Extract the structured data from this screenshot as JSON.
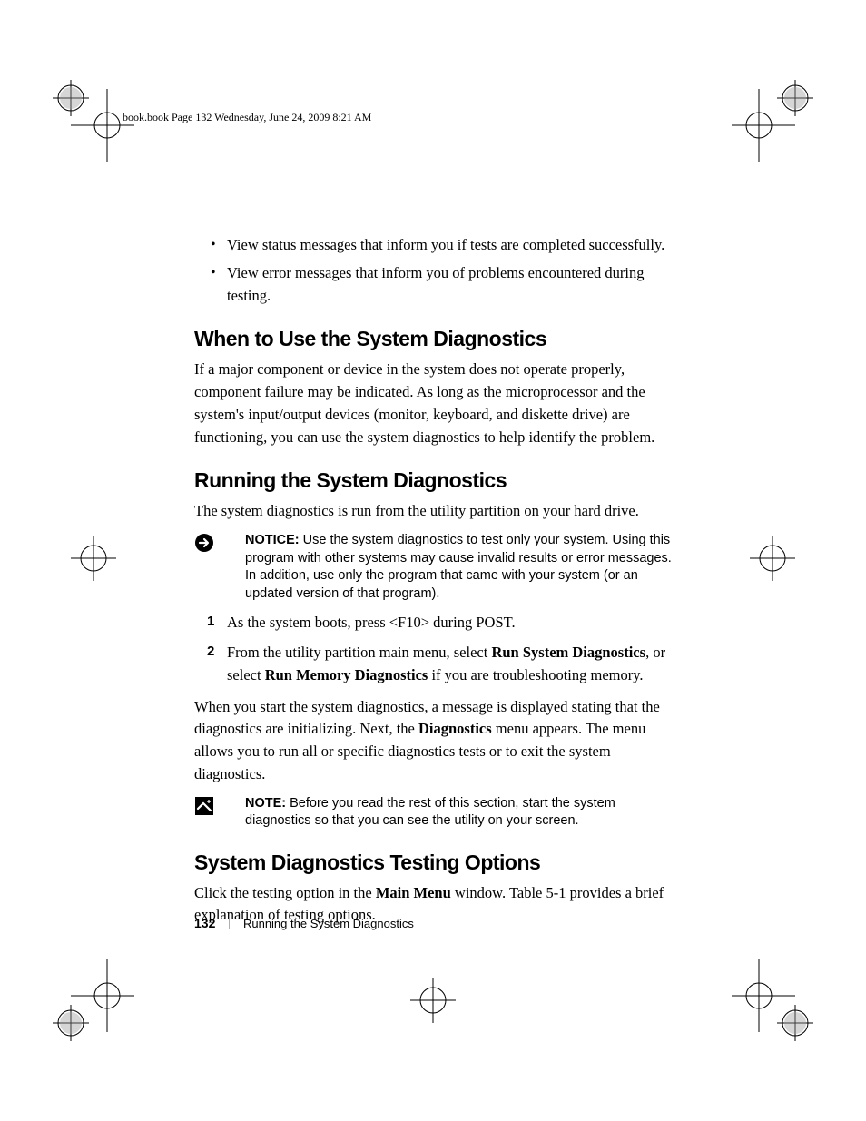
{
  "header": {
    "slug": "book.book  Page 132  Wednesday, June 24, 2009  8:21 AM"
  },
  "bullets": [
    "View status messages that inform you if tests are completed successfully.",
    "View error messages that inform you of problems encountered during testing."
  ],
  "sections": {
    "when": {
      "title": "When to Use the System Diagnostics",
      "p1": "If a major component or device in the system does not operate properly, component failure may be indicated. As long as the microprocessor and the system's input/output devices (monitor, keyboard, and diskette drive) are functioning, you can use the system diagnostics to help identify the problem."
    },
    "running": {
      "title": "Running the System Diagnostics",
      "p1": "The system diagnostics is run from the utility partition on your hard drive.",
      "notice_label": "NOTICE:",
      "notice_text": " Use the system diagnostics to test only your system. Using this program with other systems may cause invalid results or error messages. In addition, use only the program that came with your system (or an updated version of that program).",
      "step1": "As the system boots, press <F10> during POST.",
      "step2_pre": "From the utility partition main menu, select ",
      "step2_b1": "Run System Diagnostics",
      "step2_mid": ", or select ",
      "step2_b2": "Run Memory Diagnostics",
      "step2_post": " if you are troubleshooting memory.",
      "p2_pre": "When you start the system diagnostics, a message is displayed stating that the diagnostics are initializing. Next, the ",
      "p2_b": "Diagnostics",
      "p2_post": " menu appears. The menu allows you to run all or specific diagnostics tests or to exit the system diagnostics.",
      "note_label": "NOTE:",
      "note_text": " Before you read the rest of this section, start the system diagnostics so that you can see the utility on your screen."
    },
    "options": {
      "title": "System Diagnostics Testing Options",
      "p1_pre": "Click the testing option in the ",
      "p1_b": "Main Menu",
      "p1_post": " window. Table 5-1 provides a brief explanation of testing options."
    }
  },
  "footer": {
    "page": "132",
    "section": "Running the System Diagnostics"
  }
}
